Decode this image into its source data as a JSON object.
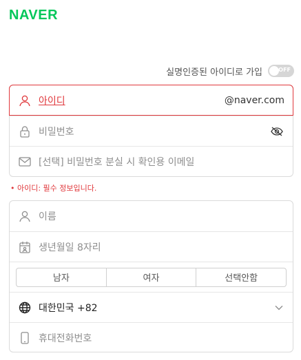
{
  "brand": {
    "logo": "NAVER",
    "color": "#03c75a"
  },
  "verify": {
    "label": "실명인증된 아이디로 가입",
    "toggle_text": "OFF",
    "toggle_on": false
  },
  "account": {
    "id_placeholder": "아이디",
    "id_suffix": "@naver.com",
    "password_placeholder": "비밀번호",
    "email_placeholder": "[선택] 비밀번호 분실 시 확인용 이메일"
  },
  "error": {
    "message": "• 아이디: 필수 정보입니다.",
    "color": "#e0373b"
  },
  "profile": {
    "name_placeholder": "이름",
    "birth_placeholder": "생년월일 8자리",
    "gender_options": [
      "남자",
      "여자",
      "선택안함"
    ],
    "country_value": "대한민국 +82",
    "phone_placeholder": "휴대전화번호"
  },
  "icons": [
    "user-icon",
    "lock-icon",
    "eye-off-icon",
    "mail-icon",
    "calendar-icon",
    "globe-icon",
    "chevron-down-icon",
    "phone-icon"
  ]
}
